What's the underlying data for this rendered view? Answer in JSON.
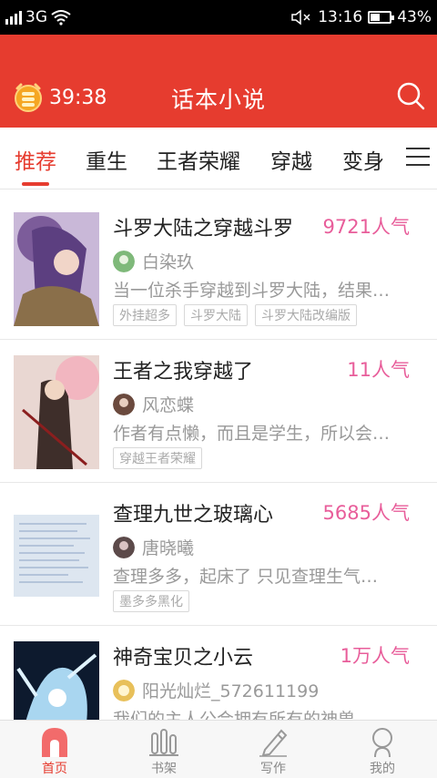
{
  "status_bar": {
    "network": "3G",
    "time": "13:16",
    "battery": "43%",
    "battery_level": 0.43
  },
  "header": {
    "timer": "39:38",
    "title": "话本小说",
    "timer_icon": "coin-clock-icon",
    "search_icon": "search-icon"
  },
  "tabs": [
    {
      "label": "推荐",
      "active": true
    },
    {
      "label": "重生"
    },
    {
      "label": "王者荣耀"
    },
    {
      "label": "穿越"
    },
    {
      "label": "变身"
    }
  ],
  "stories": [
    {
      "title": "斗罗大陆之穿越斗罗",
      "popularity": "9721人气",
      "author": "白染玖",
      "desc": "当一位杀手穿越到斗罗大陆，结果…",
      "tags": [
        "外挂超多",
        "斗罗大陆",
        "斗罗大陆改编版"
      ]
    },
    {
      "title": "王者之我穿越了",
      "popularity": "11人气",
      "author": "风恋蝶",
      "desc": "作者有点懒，而且是学生，所以会…",
      "tags": [
        "穿越王者荣耀"
      ]
    },
    {
      "title": "查理九世之玻璃心",
      "popularity": "5685人气",
      "author": "唐晓曦",
      "desc": "查理多多，起床了 只见查理生气…",
      "tags": [
        "墨多多黑化"
      ]
    },
    {
      "title": "神奇宝贝之小云",
      "popularity": "1万人气",
      "author": "阳光灿烂_572611199",
      "desc": "我们的主人公会拥有所有的神兽…",
      "tags": []
    }
  ],
  "bottom_nav": [
    {
      "label": "首页",
      "icon": "home-icon",
      "active": true
    },
    {
      "label": "书架",
      "icon": "bookshelf-icon"
    },
    {
      "label": "写作",
      "icon": "pencil-icon"
    },
    {
      "label": "我的",
      "icon": "profile-icon"
    }
  ],
  "colors": {
    "brand": "#e63c2f",
    "popularity": "#e85d9a"
  }
}
